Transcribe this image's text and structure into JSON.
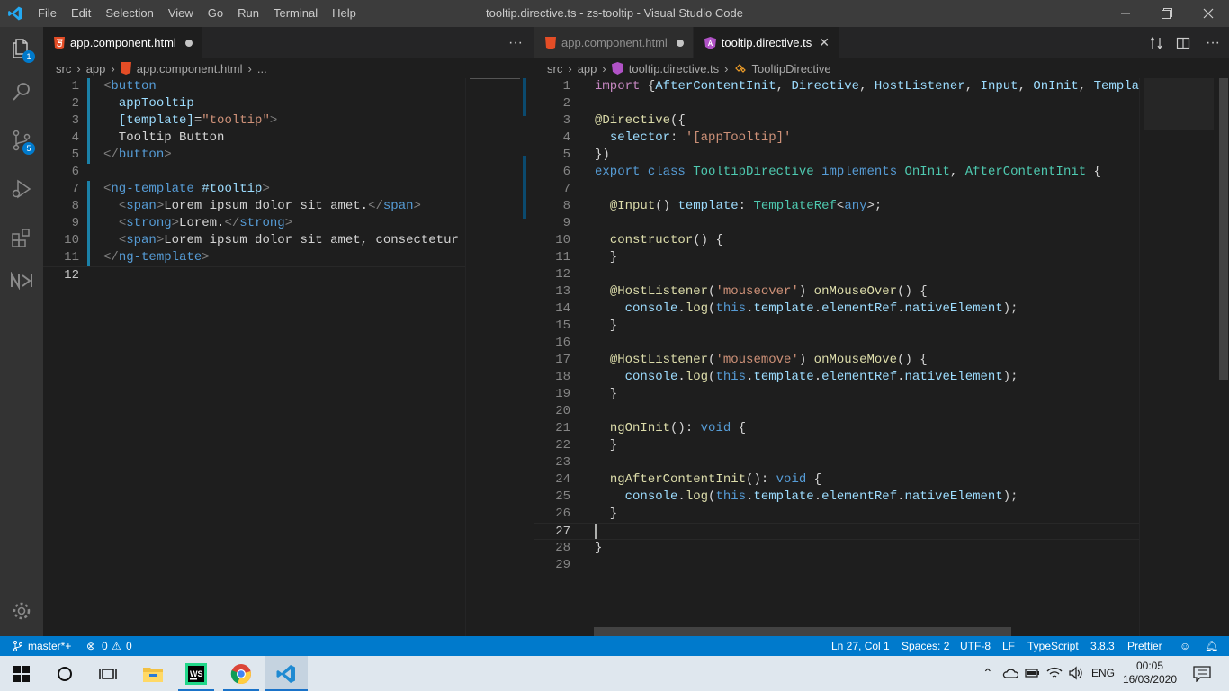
{
  "window": {
    "title": "tooltip.directive.ts - zs-tooltip - Visual Studio Code",
    "menu": [
      "File",
      "Edit",
      "Selection",
      "View",
      "Go",
      "Run",
      "Terminal",
      "Help"
    ]
  },
  "activity": {
    "explorer_badge": "1",
    "scm_badge": "5"
  },
  "left_editor": {
    "tab": {
      "label": "app.component.html",
      "modified": true
    },
    "breadcrumb": [
      "src",
      "app",
      "app.component.html",
      "..."
    ],
    "lines": [
      {
        "n": "1",
        "text": "<button"
      },
      {
        "n": "2",
        "text": "  appTooltip"
      },
      {
        "n": "3",
        "text": "  [template]=\"tooltip\">"
      },
      {
        "n": "4",
        "text": "  Tooltip Button"
      },
      {
        "n": "5",
        "text": "</button>"
      },
      {
        "n": "6",
        "text": ""
      },
      {
        "n": "7",
        "text": "<ng-template #tooltip>"
      },
      {
        "n": "8",
        "text": "  <span>Lorem ipsum dolor sit amet.</span>"
      },
      {
        "n": "9",
        "text": "  <strong>Lorem.</strong>"
      },
      {
        "n": "10",
        "text": "  <span>Lorem ipsum dolor sit amet, consectetur adipi"
      },
      {
        "n": "11",
        "text": "</ng-template>"
      },
      {
        "n": "12",
        "text": ""
      }
    ]
  },
  "right_editor": {
    "tabs": [
      {
        "label": "app.component.html",
        "modified": true
      },
      {
        "label": "tooltip.directive.ts",
        "active": true
      }
    ],
    "breadcrumb": [
      "src",
      "app",
      "tooltip.directive.ts",
      "TooltipDirective"
    ],
    "lines": [
      {
        "n": "1",
        "text": "import {AfterContentInit, Directive, HostListener, Input, OnInit, TemplateRef}"
      },
      {
        "n": "2",
        "text": ""
      },
      {
        "n": "3",
        "text": "@Directive({"
      },
      {
        "n": "4",
        "text": "  selector: '[appTooltip]'"
      },
      {
        "n": "5",
        "text": "})"
      },
      {
        "n": "6",
        "text": "export class TooltipDirective implements OnInit, AfterContentInit {"
      },
      {
        "n": "7",
        "text": ""
      },
      {
        "n": "8",
        "text": "  @Input() template: TemplateRef<any>;"
      },
      {
        "n": "9",
        "text": ""
      },
      {
        "n": "10",
        "text": "  constructor() {"
      },
      {
        "n": "11",
        "text": "  }"
      },
      {
        "n": "12",
        "text": ""
      },
      {
        "n": "13",
        "text": "  @HostListener('mouseover') onMouseOver() {"
      },
      {
        "n": "14",
        "text": "    console.log(this.template.elementRef.nativeElement);"
      },
      {
        "n": "15",
        "text": "  }"
      },
      {
        "n": "16",
        "text": ""
      },
      {
        "n": "17",
        "text": "  @HostListener('mousemove') onMouseMove() {"
      },
      {
        "n": "18",
        "text": "    console.log(this.template.elementRef.nativeElement);"
      },
      {
        "n": "19",
        "text": "  }"
      },
      {
        "n": "20",
        "text": ""
      },
      {
        "n": "21",
        "text": "  ngOnInit(): void {"
      },
      {
        "n": "22",
        "text": "  }"
      },
      {
        "n": "23",
        "text": ""
      },
      {
        "n": "24",
        "text": "  ngAfterContentInit(): void {"
      },
      {
        "n": "25",
        "text": "    console.log(this.template.elementRef.nativeElement);"
      },
      {
        "n": "26",
        "text": "  }"
      },
      {
        "n": "27",
        "text": ""
      },
      {
        "n": "28",
        "text": "}"
      },
      {
        "n": "29",
        "text": ""
      }
    ]
  },
  "statusbar": {
    "branch": "master*+",
    "errors": "0",
    "warnings": "0",
    "position": "Ln 27, Col 1",
    "spaces": "Spaces: 2",
    "encoding": "UTF-8",
    "eol": "LF",
    "language": "TypeScript",
    "ts_version": "3.8.3",
    "formatter": "Prettier"
  },
  "taskbar": {
    "language": "ENG",
    "time": "00:05",
    "date": "16/03/2020",
    "webstorm_label": "WS"
  },
  "colors": {
    "accent": "#007acc",
    "titlebar": "#3c3c3c",
    "activitybar": "#333333",
    "editor": "#1e1e1e"
  }
}
